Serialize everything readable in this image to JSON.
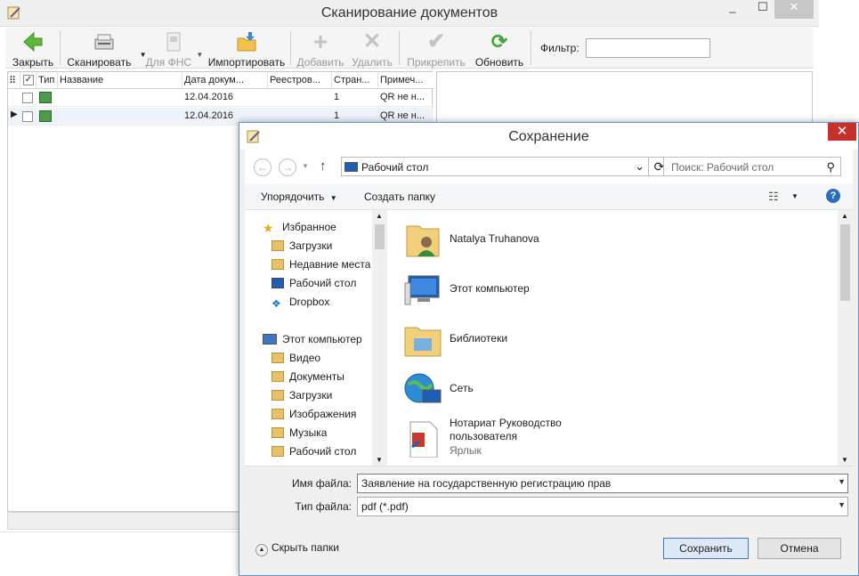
{
  "main": {
    "title": "Сканирование документов",
    "window_buttons": [
      "_",
      "☐",
      "✕"
    ],
    "toolbar": {
      "close": "Закрыть",
      "scan": "Сканировать",
      "fns": "Для ФНС",
      "import": "Импортировать",
      "add": "Добавить",
      "delete": "Удалить",
      "attach": "Прикрепить",
      "refresh": "Обновить",
      "filter_label": "Фильтр:",
      "filter_value": ""
    },
    "grid": {
      "columns": [
        "Тип",
        "Название",
        "Дата докум...",
        "Реестров...",
        "Стран...",
        "Примеч..."
      ],
      "rows": [
        {
          "name": "",
          "date": "12.04.2016",
          "registry": "",
          "pages": "1",
          "note": "QR не н..."
        },
        {
          "name": "",
          "date": "12.04.2016",
          "registry": "",
          "pages": "1",
          "note": "QR не н..."
        }
      ]
    }
  },
  "dialog": {
    "title": "Сохранение",
    "close": "✕",
    "address": "Рабочий стол",
    "search_placeholder": "Поиск: Рабочий стол",
    "organize": "Упорядочить",
    "new_folder": "Создать папку",
    "help": "?",
    "nav": {
      "favorites": "Избранное",
      "fav_items": [
        "Загрузки",
        "Недавние места",
        "Рабочий стол",
        "Dropbox"
      ],
      "computer": "Этот компьютер",
      "comp_items": [
        "Видео",
        "Документы",
        "Загрузки",
        "Изображения",
        "Музыка",
        "Рабочий стол"
      ]
    },
    "files": [
      {
        "name": "Natalya Truhanova",
        "sub": ""
      },
      {
        "name": "Этот компьютер",
        "sub": ""
      },
      {
        "name": "Библиотеки",
        "sub": ""
      },
      {
        "name": "Сеть",
        "sub": ""
      },
      {
        "name": "Нотариат Руководство",
        "name2": "пользователя",
        "sub": "Ярлык"
      }
    ],
    "filename_label": "Имя файла:",
    "filename_value": "Заявление на государственную регистрацию прав",
    "filetype_label": "Тип файла:",
    "filetype_value": "pdf (*.pdf)",
    "hide_folders": "Скрыть папки",
    "save": "Сохранить",
    "cancel": "Отмена"
  }
}
